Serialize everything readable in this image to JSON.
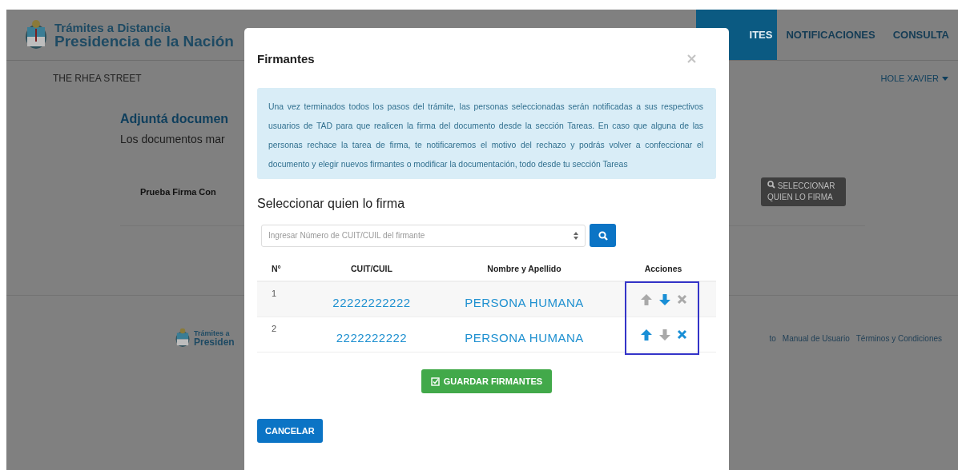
{
  "header": {
    "logo_line1": "Trámites a Distancia",
    "logo_line2": "Presidencia de la Nación",
    "nav": [
      {
        "label": "ITES",
        "selected": true
      },
      {
        "label": "NOTIFICACIONES",
        "selected": false
      },
      {
        "label": "CONSULTA",
        "selected": false
      }
    ]
  },
  "subbar": {
    "location": "THE RHEA STREET",
    "user": "HOLE XAVIER"
  },
  "page": {
    "heading": "Adjuntá documen",
    "subtext": "Los documentos mar",
    "document_label": "Prueba Firma Con",
    "select_button": "SELECCIONAR QUIEN LO FIRMA"
  },
  "footer": {
    "logo_line1": "Trámites a",
    "logo_line2": "Presiden",
    "links": [
      "to",
      "Manual de Usuario",
      "Términos y Condiciones"
    ]
  },
  "modal": {
    "title": "Firmantes",
    "info": "Una vez terminados todos los pasos del trámite, las personas seleccionadas serán notificadas a sus respectivos usuarios de TAD para que realicen la firma del documento desde la sección Tareas. En caso que alguna de las personas rechace la tarea de firma, te notificaremos el motivo del rechazo y podrás volver a confeccionar el documento y elegir nuevos firmantes o modificar la documentación, todo desde tu sección Tareas",
    "section_title": "Seleccionar quien lo firma",
    "search": {
      "placeholder": "Ingresar Número de CUIT/CUIL del firmante"
    },
    "columns": [
      "N°",
      "CUIT/CUIL",
      "Nombre y Apellido",
      "Acciones"
    ],
    "rows": [
      {
        "number": "1",
        "cuit": "22222222222",
        "name": "PERSONA HUMANA",
        "actions": [
          {
            "kind": "up",
            "disabled": true
          },
          {
            "kind": "down",
            "disabled": false
          },
          {
            "kind": "remove",
            "disabled": true
          }
        ]
      },
      {
        "number": "2",
        "cuit": "2222222222",
        "name": "PERSONA HUMANA",
        "actions": [
          {
            "kind": "up",
            "disabled": false
          },
          {
            "kind": "down",
            "disabled": true
          },
          {
            "kind": "remove",
            "disabled": false
          }
        ]
      }
    ],
    "save_button": "GUARDAR FIRMANTES",
    "cancel_button": "CANCELAR"
  }
}
